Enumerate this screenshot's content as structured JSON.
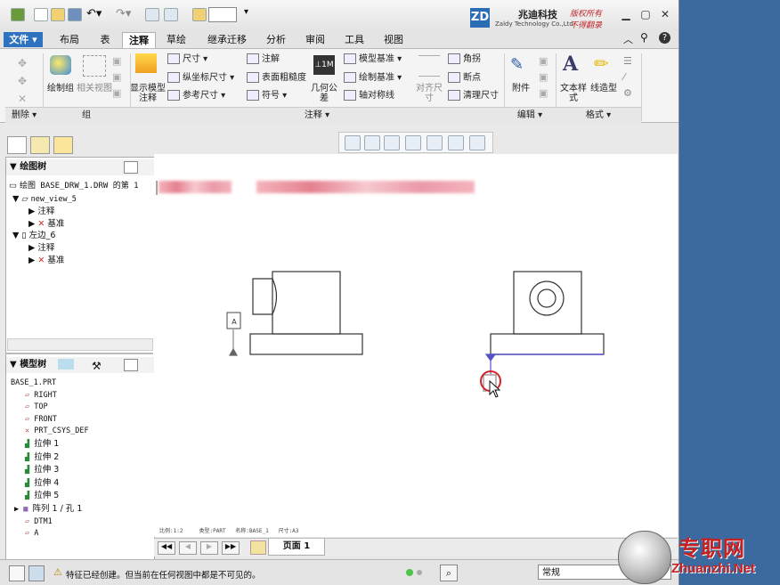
{
  "titlebar": {
    "brand_cn": "兆迪科技",
    "brand_en": "Zaldy Technology Co.,Ltd.",
    "logo_letter": "ZD",
    "copyright_1": "版权所有",
    "copyright_2": "不得翻录"
  },
  "tabs": {
    "file": "文件 ▾",
    "items": [
      "布局",
      "表",
      "注释",
      "草绘",
      "继承迁移",
      "分析",
      "审阅",
      "工具",
      "视图"
    ],
    "active": "注释"
  },
  "ribbon": {
    "draw_group": "绘制组",
    "related_view": "相关视图",
    "show_model_ann": "显示模型注释",
    "dim": "尺寸 ▾",
    "ord_dim": "纵坐标尺寸 ▾",
    "ref_dim": "参考尺寸 ▾",
    "note": "注解",
    "surface_finish": "表面粗糙度",
    "symbol": "符号 ▾",
    "geom_tol": "几何公差",
    "model_datum": "模型基准 ▾",
    "draw_datum": "绘制基准 ▾",
    "axis_sym": "轴对称线",
    "align_dim": "对齐尺寸",
    "corner": "角拐",
    "breakpoint": "断点",
    "clean_dim": "清理尺寸",
    "attach": "附件",
    "text_style": "文本样式",
    "line_style": "线造型",
    "groups": {
      "delete": "删除 ▾",
      "group": "组",
      "annotate": "注释 ▾",
      "edit": "编辑 ▾",
      "format": "格式 ▾"
    }
  },
  "drawing_tree": {
    "title": "绘图树",
    "items": [
      {
        "text": "绘图 BASE_DRW_1.DRW 的第 1"
      },
      {
        "text": "new_view_5"
      },
      {
        "text": "注释"
      },
      {
        "text": "基准"
      },
      {
        "text": "左边_6"
      },
      {
        "text": "注释"
      },
      {
        "text": "基准"
      }
    ]
  },
  "model_tree": {
    "title": "模型树",
    "root": "BASE_1.PRT",
    "items": [
      "RIGHT",
      "TOP",
      "FRONT",
      "PRT_CSYS_DEF",
      "拉伸 1",
      "拉伸 2",
      "拉伸 3",
      "拉伸 4",
      "拉伸 5",
      "阵列 1 / 孔 1",
      "DTM1",
      "A"
    ]
  },
  "drawing": {
    "datum_label": "A",
    "info_line": {
      "scale": "比例:1:2",
      "type": "类型:PART",
      "name": "名称:BASE_1",
      "size": "尺寸:A3"
    }
  },
  "pagebar": {
    "page_label": "页面 1"
  },
  "status": {
    "message": "特征已经创建。但当前在任何视图中都是不可见的。",
    "filter": "常规"
  },
  "watermark": {
    "cn": "专职网",
    "url": "Zhuanzhi.Net"
  }
}
